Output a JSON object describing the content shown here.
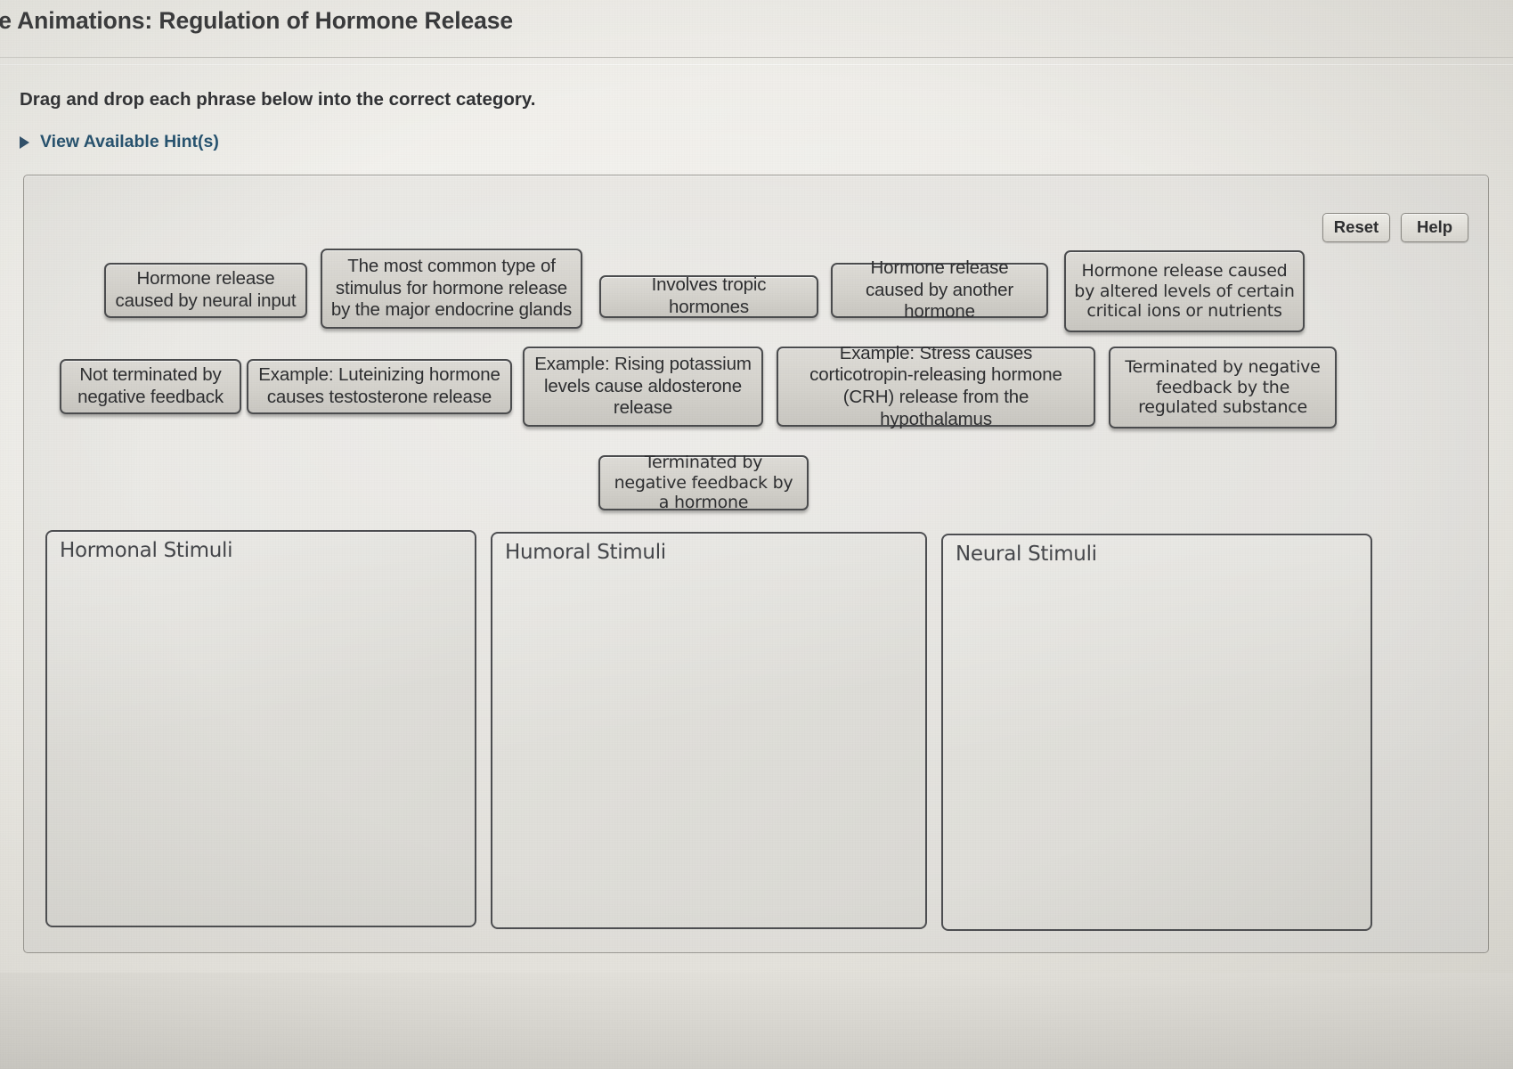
{
  "header": {
    "title": "re Animations: Regulation of Hormone Release"
  },
  "instructions": {
    "prompt": "Drag and drop each phrase below into the correct category.",
    "hints_label": "View Available Hint(s)"
  },
  "panel": {
    "reset_label": "Reset",
    "help_label": "Help"
  },
  "tiles": [
    {
      "id": "neural-input",
      "text": "Hormone release caused by neural input"
    },
    {
      "id": "most-common",
      "text": "The most common type of stimulus for hormone release by the major endocrine glands"
    },
    {
      "id": "tropic-hormones",
      "text": "Involves tropic hormones"
    },
    {
      "id": "another-hormone",
      "text": "Hormone release caused by another hormone"
    },
    {
      "id": "altered-ions",
      "text": "Hormone release caused by altered levels of certain critical ions or nutrients"
    },
    {
      "id": "not-terminated",
      "text": "Not terminated by negative feedback"
    },
    {
      "id": "lh-testosterone",
      "text": "Example: Luteinizing hormone causes testosterone release"
    },
    {
      "id": "potassium-aldo",
      "text": "Example: Rising potassium levels cause aldosterone release"
    },
    {
      "id": "stress-crh",
      "text": "Example: Stress causes corticotropin-releasing hormone (CRH) release from the hypothalamus"
    },
    {
      "id": "term-regulated",
      "text": "Terminated by negative feedback by the regulated substance"
    },
    {
      "id": "term-hormone",
      "text": "Terminated by negative feedback by a hormone"
    }
  ],
  "categories": [
    {
      "id": "hormonal",
      "label": "Hormonal Stimuli"
    },
    {
      "id": "humoral",
      "label": "Humoral Stimuli"
    },
    {
      "id": "neural",
      "label": "Neural Stimuli"
    }
  ],
  "colors": {
    "page_background": "#e9e8e2",
    "panel_background": "#e3e1dc",
    "tile_fill": "#d4d2cc",
    "tile_border": "#4a4b4d",
    "hint_link": "#24526f",
    "title_text": "#37383a"
  }
}
